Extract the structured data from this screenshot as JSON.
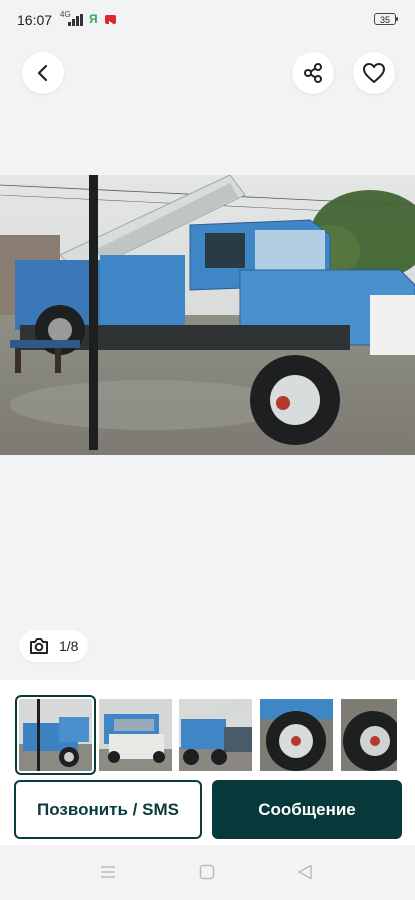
{
  "status_bar": {
    "time": "16:07",
    "network": "4G",
    "battery": "35"
  },
  "header": {
    "back_icon": "arrow-left-icon",
    "share_icon": "share-icon",
    "favorite_icon": "heart-outline-icon"
  },
  "gallery": {
    "counter": "1/8",
    "camera_icon": "camera-icon",
    "thumbnails": [
      "photo-1",
      "photo-2",
      "photo-3",
      "photo-4",
      "photo-5"
    ]
  },
  "actions": {
    "call_label": "Позвонить / SMS",
    "message_label": "Сообщение"
  },
  "colors": {
    "accent_dark_teal": "#07393a",
    "truck_blue": "#3f86c6",
    "background": "#f2f3f5"
  }
}
